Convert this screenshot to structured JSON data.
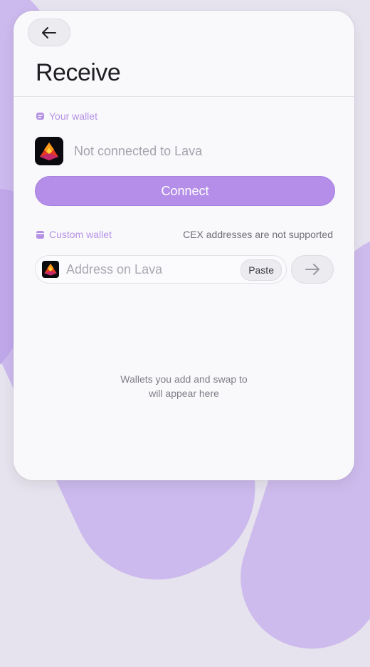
{
  "header": {
    "title": "Receive",
    "back_icon": "arrow-left-icon"
  },
  "your_wallet": {
    "label": "Your wallet",
    "icon": "wallet-icon",
    "status": "Not connected to Lava",
    "connect_label": "Connect"
  },
  "custom_wallet": {
    "label": "Custom wallet",
    "icon": "folder-icon",
    "note": "CEX addresses are not supported",
    "address_placeholder": "Address on Lava",
    "paste_label": "Paste",
    "submit_icon": "arrow-right-icon"
  },
  "empty_state": {
    "line1": "Wallets you add and swap to",
    "line2": "will appear here"
  },
  "colors": {
    "accent": "#b48ee9",
    "accent_text": "#b592e6",
    "background": "#f9f9fb"
  }
}
